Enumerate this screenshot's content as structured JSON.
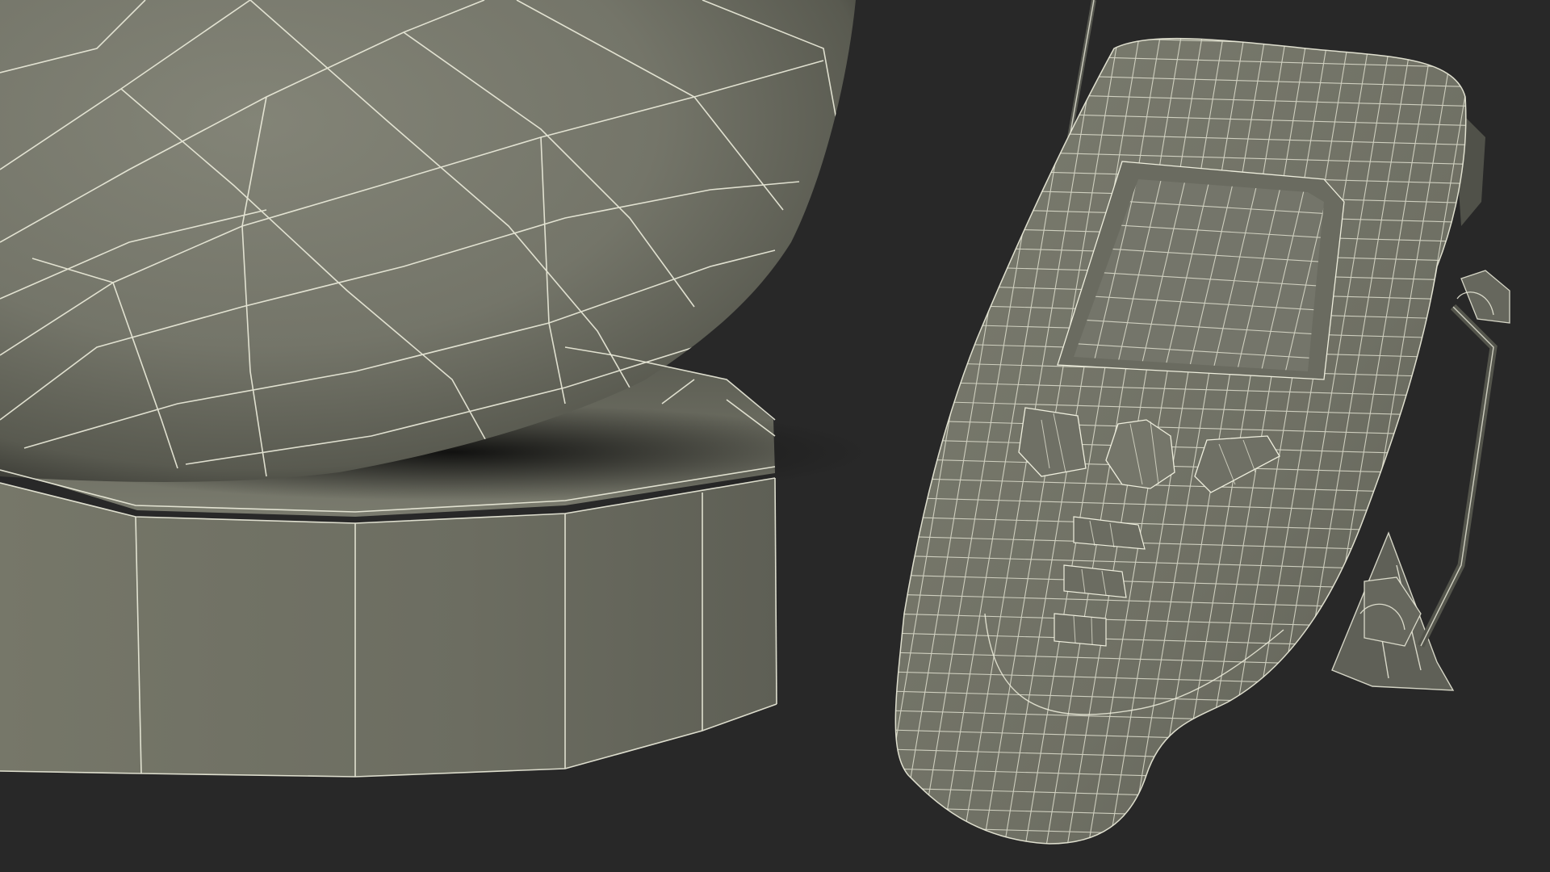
{
  "scene": {
    "kind": "3d-wireframe-render",
    "objects": [
      {
        "id": "sphere-on-ring-base",
        "label": "",
        "parts": [
          "sphere",
          "octagonal-base-ring"
        ]
      },
      {
        "id": "handheld-meter",
        "label": "",
        "parts": [
          "body",
          "screen",
          "keypad",
          "kickstand",
          "probe-clips",
          "antenna-cable"
        ]
      }
    ]
  },
  "colors": {
    "background": "#282828",
    "surface_light": "#7c7d70",
    "surface_mid": "#6d6e62",
    "surface_dark": "#4a4b42",
    "occlusion": "#1c1c1a",
    "wire": "#eeeedd"
  }
}
